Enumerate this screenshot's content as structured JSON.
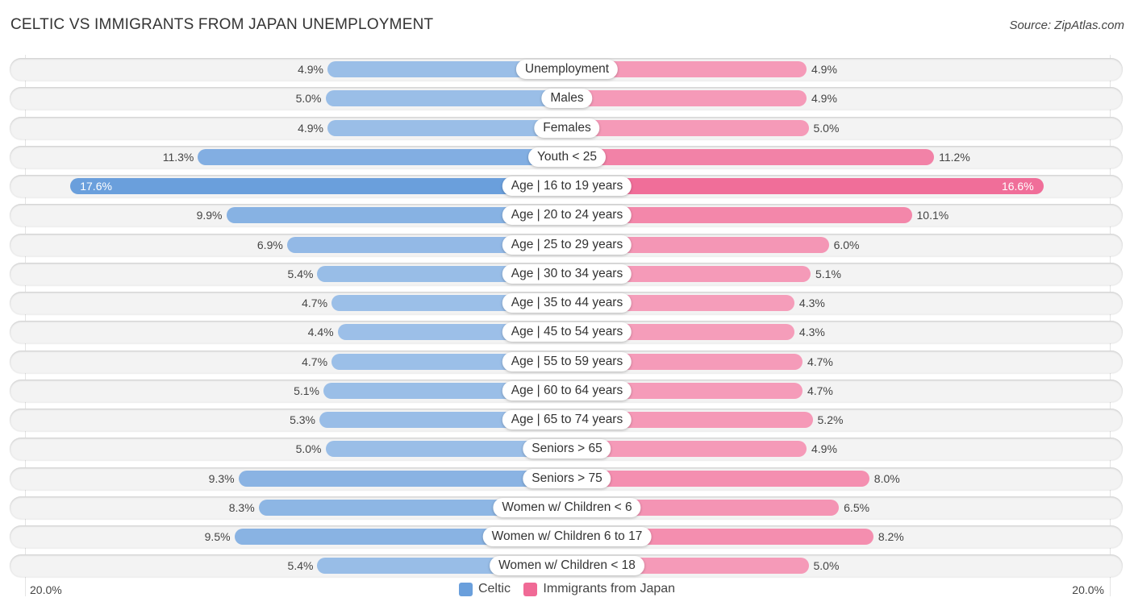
{
  "chart_data": {
    "type": "bar",
    "orientation": "horizontal-diverging",
    "title": "CELTIC VS IMMIGRANTS FROM JAPAN UNEMPLOYMENT",
    "source": "Source: ZipAtlas.com",
    "categories": [
      "Unemployment",
      "Males",
      "Females",
      "Youth < 25",
      "Age | 16 to 19 years",
      "Age | 20 to 24 years",
      "Age | 25 to 29 years",
      "Age | 30 to 34 years",
      "Age | 35 to 44 years",
      "Age | 45 to 54 years",
      "Age | 55 to 59 years",
      "Age | 60 to 64 years",
      "Age | 65 to 74 years",
      "Seniors > 65",
      "Seniors > 75",
      "Women w/ Children < 6",
      "Women w/ Children 6 to 17",
      "Women w/ Children < 18"
    ],
    "series": [
      {
        "name": "Celtic",
        "color": "#6a9fdc",
        "values": [
          4.9,
          5.0,
          4.9,
          11.3,
          17.6,
          9.9,
          6.9,
          5.4,
          4.7,
          4.4,
          4.7,
          5.1,
          5.3,
          5.0,
          9.3,
          8.3,
          9.5,
          5.4
        ]
      },
      {
        "name": "Immigrants from Japan",
        "color": "#f06a96",
        "values": [
          4.9,
          4.9,
          5.0,
          11.2,
          16.6,
          10.1,
          6.0,
          5.1,
          4.3,
          4.3,
          4.7,
          4.7,
          5.2,
          4.9,
          8.0,
          6.5,
          8.2,
          5.0
        ]
      }
    ],
    "axis": {
      "left_label": "20.0%",
      "right_label": "20.0%",
      "max": 20.0
    },
    "legend_position": "bottom-center",
    "value_suffix": "%"
  }
}
